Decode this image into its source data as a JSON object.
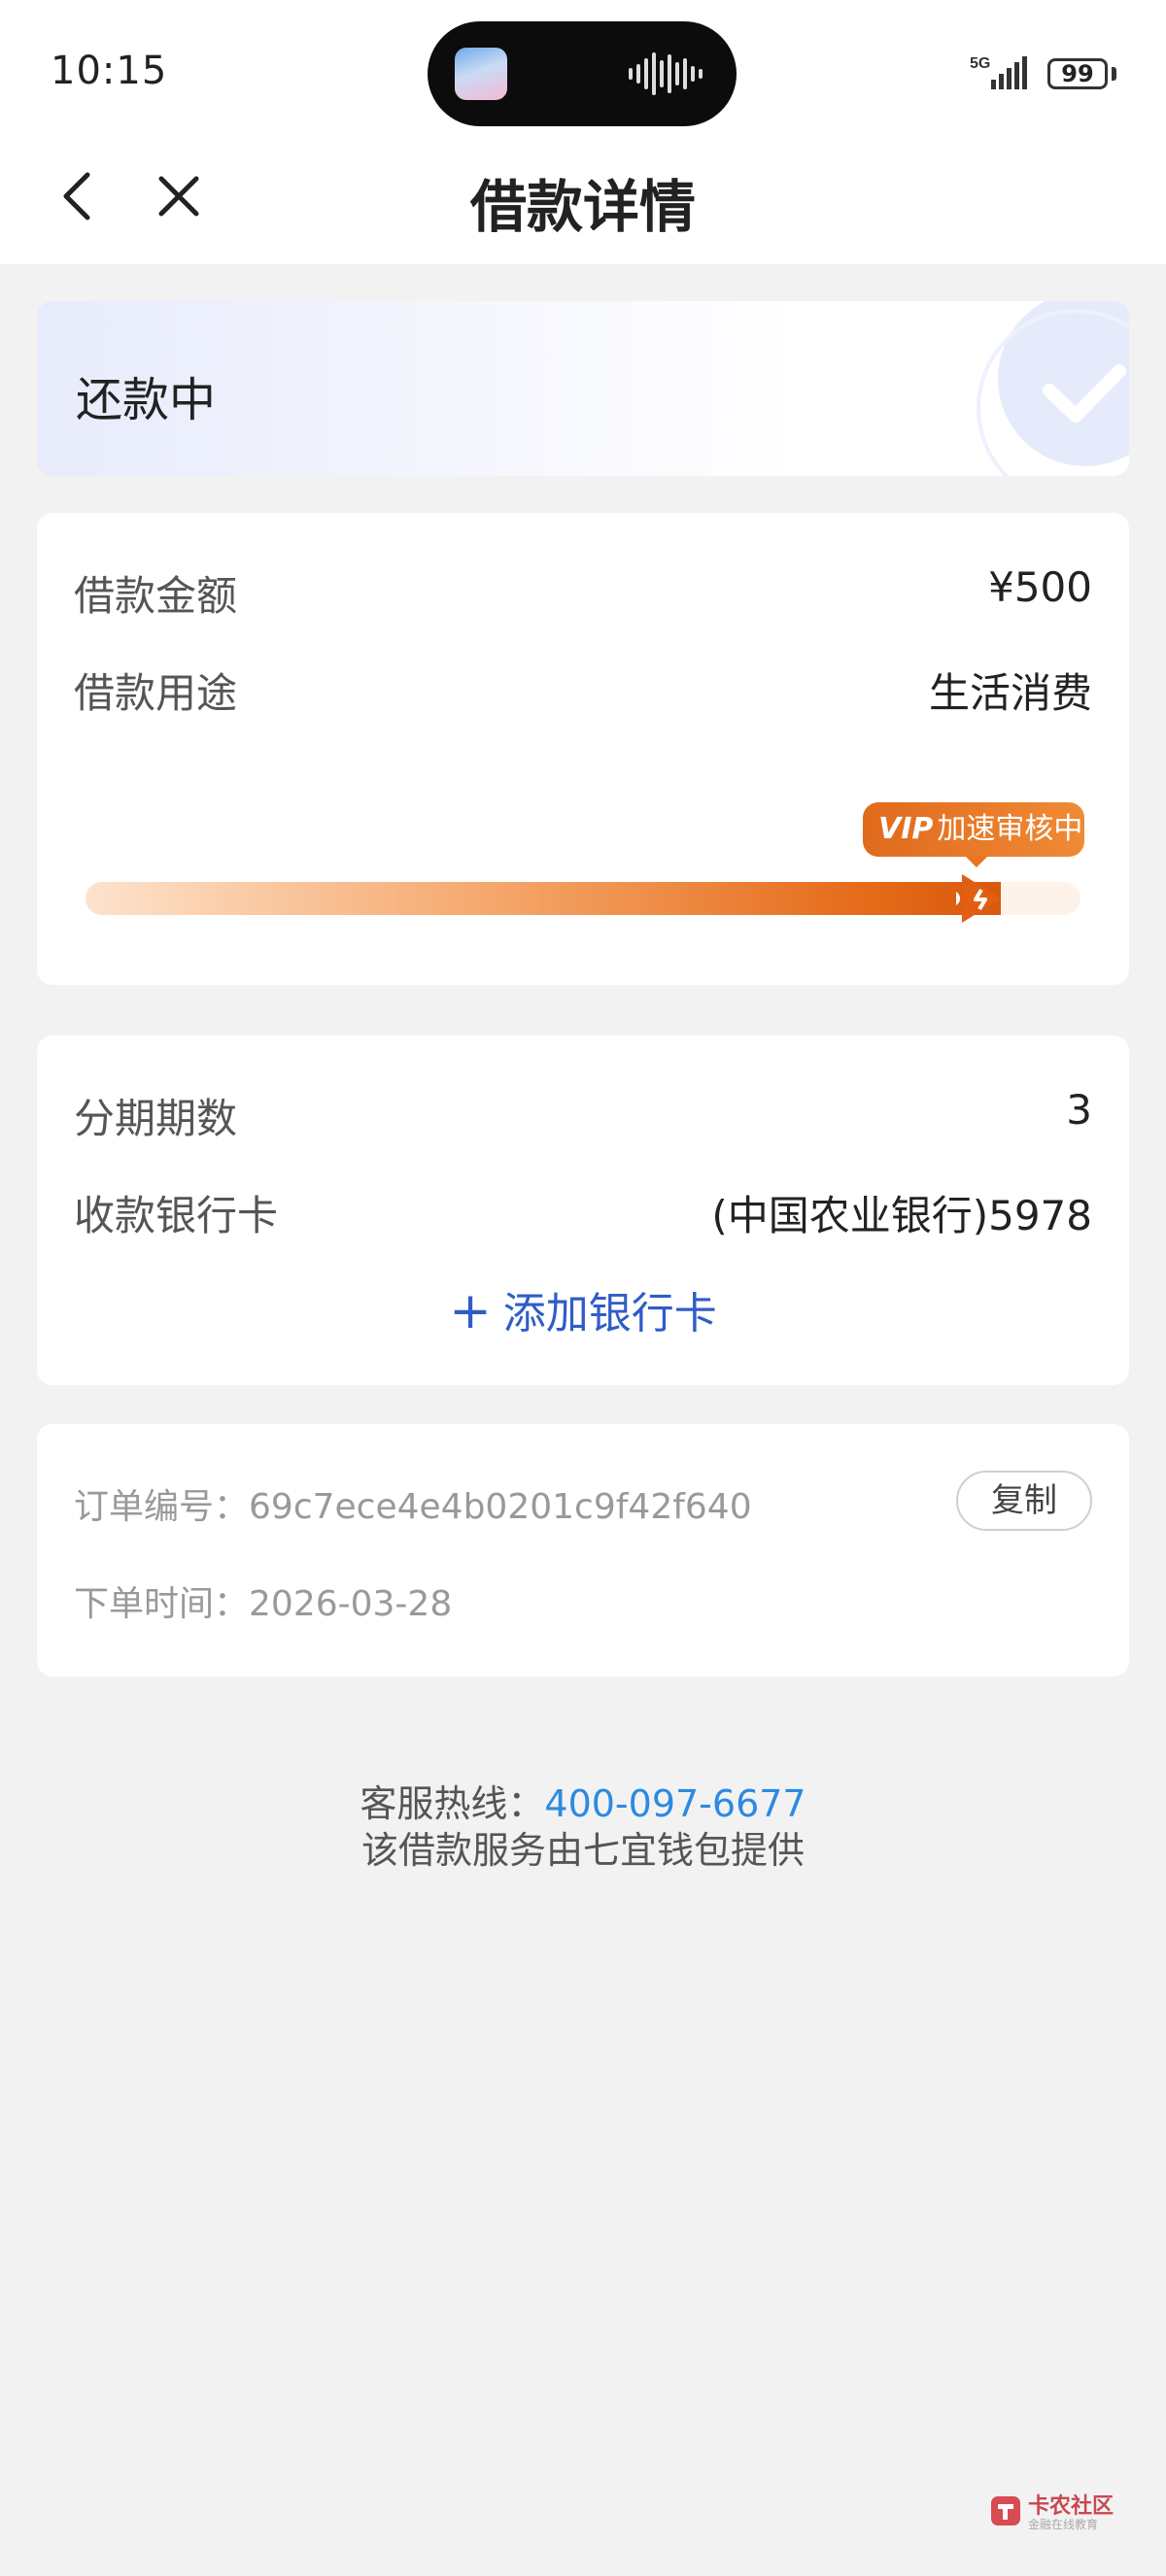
{
  "status_bar": {
    "time": "10:15",
    "network": "5G",
    "battery": "99"
  },
  "header": {
    "title": "借款详情",
    "back_icon": "chevron-left-icon",
    "close_icon": "close-icon"
  },
  "loan_status": {
    "label": "还款中",
    "icon": "check-circle-icon"
  },
  "loan_info": {
    "amount_label": "借款金额",
    "amount_value": "¥500",
    "purpose_label": "借款用途",
    "purpose_value": "生活消费",
    "vip_prefix": "VIP",
    "vip_text": "加速审核中",
    "progress": 0.92
  },
  "installment": {
    "periods_label": "分期期数",
    "periods_value": "3",
    "bank_label": "收款银行卡",
    "bank_value": "(中国农业银行)5978",
    "add_card_label": "添加银行卡"
  },
  "order": {
    "id_label": "订单编号：",
    "id_value": "69c7ece4e4b0201c9f42f640",
    "copy_label": "复制",
    "time_label": "下单时间：",
    "time_value": "2026-03-28"
  },
  "footer": {
    "hotline_label": "客服热线：",
    "hotline_number": "400-097-6677",
    "provider_text": "该借款服务由七宜钱包提供"
  },
  "watermark": {
    "name": "卡农社区",
    "sub": "金融在线教育"
  },
  "colors": {
    "accent_blue": "#2f5dc8",
    "link_blue": "#2c8ae0",
    "progress_orange": "#e56b1a"
  }
}
